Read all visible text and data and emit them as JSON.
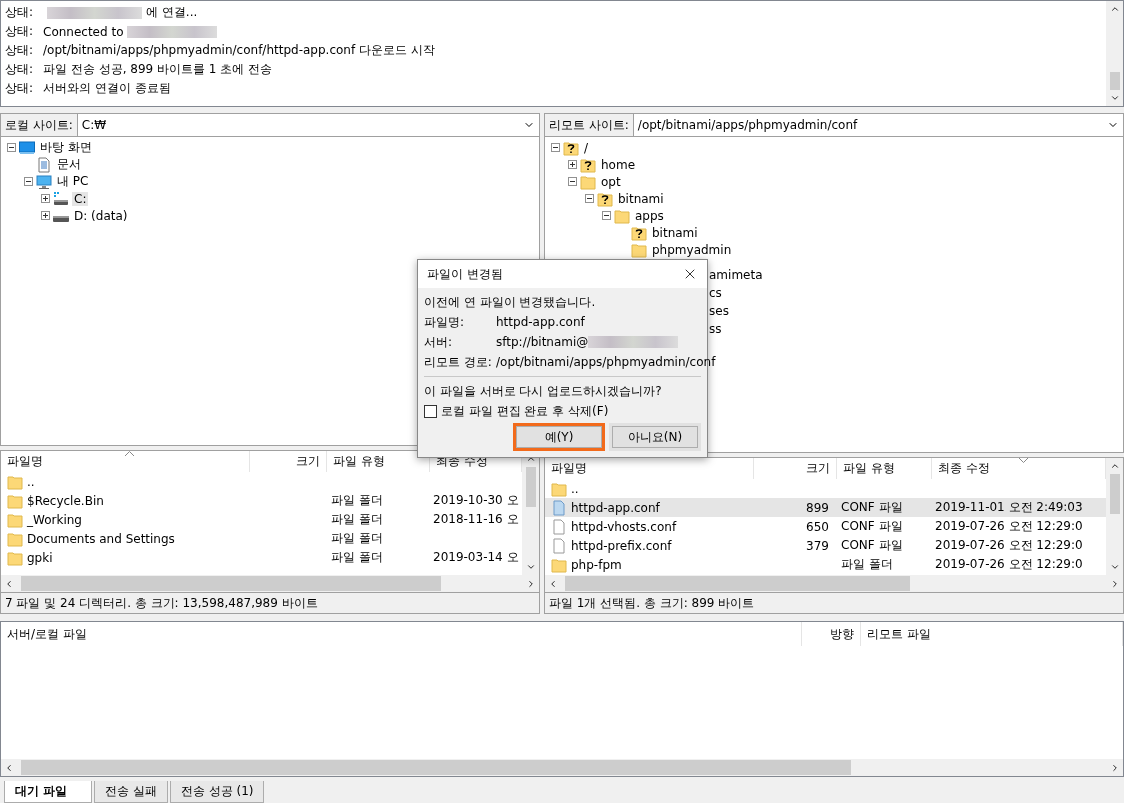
{
  "log": {
    "lines": [
      {
        "label": "상태:",
        "parts": [
          {
            "kind": "redacted"
          },
          {
            "kind": "text",
            "text": "에 연결..."
          }
        ]
      },
      {
        "label": "상태:",
        "parts": [
          {
            "kind": "text",
            "text": "Connected to"
          },
          {
            "kind": "redacted"
          }
        ]
      },
      {
        "label": "상태:",
        "parts": [
          {
            "kind": "text",
            "text": "/opt/bitnami/apps/phpmyadmin/conf/httpd-app.conf 다운로드 시작"
          }
        ]
      },
      {
        "label": "상태:",
        "parts": [
          {
            "kind": "text",
            "text": "파일 전송 성공, 899 바이트를 1 초에 전송"
          }
        ]
      },
      {
        "label": "상태:",
        "parts": [
          {
            "kind": "text",
            "text": "서버와의 연결이 종료됨"
          }
        ]
      }
    ]
  },
  "local": {
    "site_label": "로컬 사이트:",
    "path": "C:₩",
    "tree": [
      {
        "label": "바탕 화면",
        "kind": "desktop",
        "expanded": true,
        "selected": false,
        "children": [
          {
            "label": "문서",
            "kind": "document",
            "selected": false
          },
          {
            "label": "내 PC",
            "kind": "computer",
            "expanded": true,
            "selected": false,
            "children": [
              {
                "label": "C:",
                "kind": "system-drive",
                "expanded": false,
                "selected": true
              },
              {
                "label": "D: (data)",
                "kind": "drive",
                "expanded": false,
                "selected": false
              }
            ]
          }
        ]
      }
    ],
    "columns": [
      {
        "label": "파일명",
        "sort_ascending": true
      },
      {
        "label": "크기"
      },
      {
        "label": "파일 유형"
      },
      {
        "label": "최종 수정"
      }
    ],
    "rows": [
      {
        "name": "..",
        "kind": "folder",
        "selected": false
      },
      {
        "name": "$Recycle.Bin",
        "kind": "folder",
        "type": "파일 폴더",
        "modified": "2019-10-30 오",
        "selected": false
      },
      {
        "name": "_Working",
        "kind": "folder",
        "type": "파일 폴더",
        "modified": "2018-11-16 오",
        "selected": false
      },
      {
        "name": "Documents and Settings",
        "kind": "folder",
        "type": "파일 폴더",
        "selected": false
      },
      {
        "name": "gpki",
        "kind": "folder",
        "type": "파일 폴더",
        "modified": "2019-03-14 오",
        "selected": false
      }
    ],
    "status": "7 파일 및 24 디렉터리. 총 크기: 13,598,487,989 바이트"
  },
  "remote": {
    "site_label": "리모트 사이트:",
    "path": "/opt/bitnami/apps/phpmyadmin/conf",
    "tree": [
      {
        "label": "/",
        "kind": "unknown-folder",
        "expanded": true,
        "selected": false,
        "children": [
          {
            "label": "home",
            "kind": "unknown-folder",
            "expanded": false,
            "selected": false
          },
          {
            "label": "opt",
            "kind": "folder",
            "expanded": true,
            "selected": false,
            "children": [
              {
                "label": "bitnami",
                "kind": "unknown-folder",
                "expanded": true,
                "selected": false,
                "children": [
                  {
                    "label": "apps",
                    "kind": "folder",
                    "expanded": true,
                    "selected": false,
                    "children": [
                      {
                        "label": "bitnami",
                        "kind": "unknown-folder",
                        "selected": false
                      },
                      {
                        "label": "phpmyadmin",
                        "kind": "folder",
                        "selected": false
                      }
                    ]
                  }
                ]
              }
            ]
          }
        ]
      }
    ],
    "covered_labels": [
      "amimeta",
      "cs",
      "ses",
      "ss"
    ],
    "columns": [
      {
        "label": "파일명"
      },
      {
        "label": "크기"
      },
      {
        "label": "파일 유형"
      },
      {
        "label": "최종 수정",
        "sort_ascending": false
      }
    ],
    "rows": [
      {
        "name": "..",
        "kind": "folder",
        "selected": false
      },
      {
        "name": "httpd-app.conf",
        "kind": "conf-file",
        "size": "899",
        "type": "CONF 파일",
        "modified": "2019-11-01 오전 2:49:03",
        "selected": true
      },
      {
        "name": "httpd-vhosts.conf",
        "kind": "file",
        "size": "650",
        "type": "CONF 파일",
        "modified": "2019-07-26 오전 12:29:0",
        "selected": false
      },
      {
        "name": "httpd-prefix.conf",
        "kind": "file",
        "size": "379",
        "type": "CONF 파일",
        "modified": "2019-07-26 오전 12:29:0",
        "selected": false
      },
      {
        "name": "php-fpm",
        "kind": "folder",
        "type": "파일 폴더",
        "modified": "2019-07-26 오전 12:29:0",
        "selected": false
      }
    ],
    "status": "파일 1개 선택됨. 총 크기: 899 바이트"
  },
  "queue": {
    "columns": [
      {
        "label": "서버/로컬 파일"
      },
      {
        "label": "방향"
      },
      {
        "label": "리모트 파일"
      }
    ],
    "tabs": [
      {
        "label": "대기 파일",
        "selected": true
      },
      {
        "label": "전송 실패",
        "selected": false
      },
      {
        "label": "전송 성공 (1)",
        "selected": false
      }
    ]
  },
  "dialog": {
    "title": "파일이 변경됨",
    "message": "이전에 연 파일이 변경됐습니다.",
    "fields": [
      {
        "label": "파일명:",
        "value": "httpd-app.conf"
      },
      {
        "label": "서버:",
        "value": "sftp://bitnami@",
        "redacted": true
      },
      {
        "label": "리모트 경로:",
        "value": "/opt/bitnami/apps/phpmyadmin/conf"
      }
    ],
    "question": "이 파일을 서버로 다시 업로드하시겠습니까?",
    "checkbox": {
      "label": "로컬 파일 편집 완료 후 삭제(F)",
      "checked": false
    },
    "buttons": [
      {
        "label": "예(Y)",
        "focused": true
      },
      {
        "label": "아니요(N)",
        "focused": false
      }
    ]
  }
}
